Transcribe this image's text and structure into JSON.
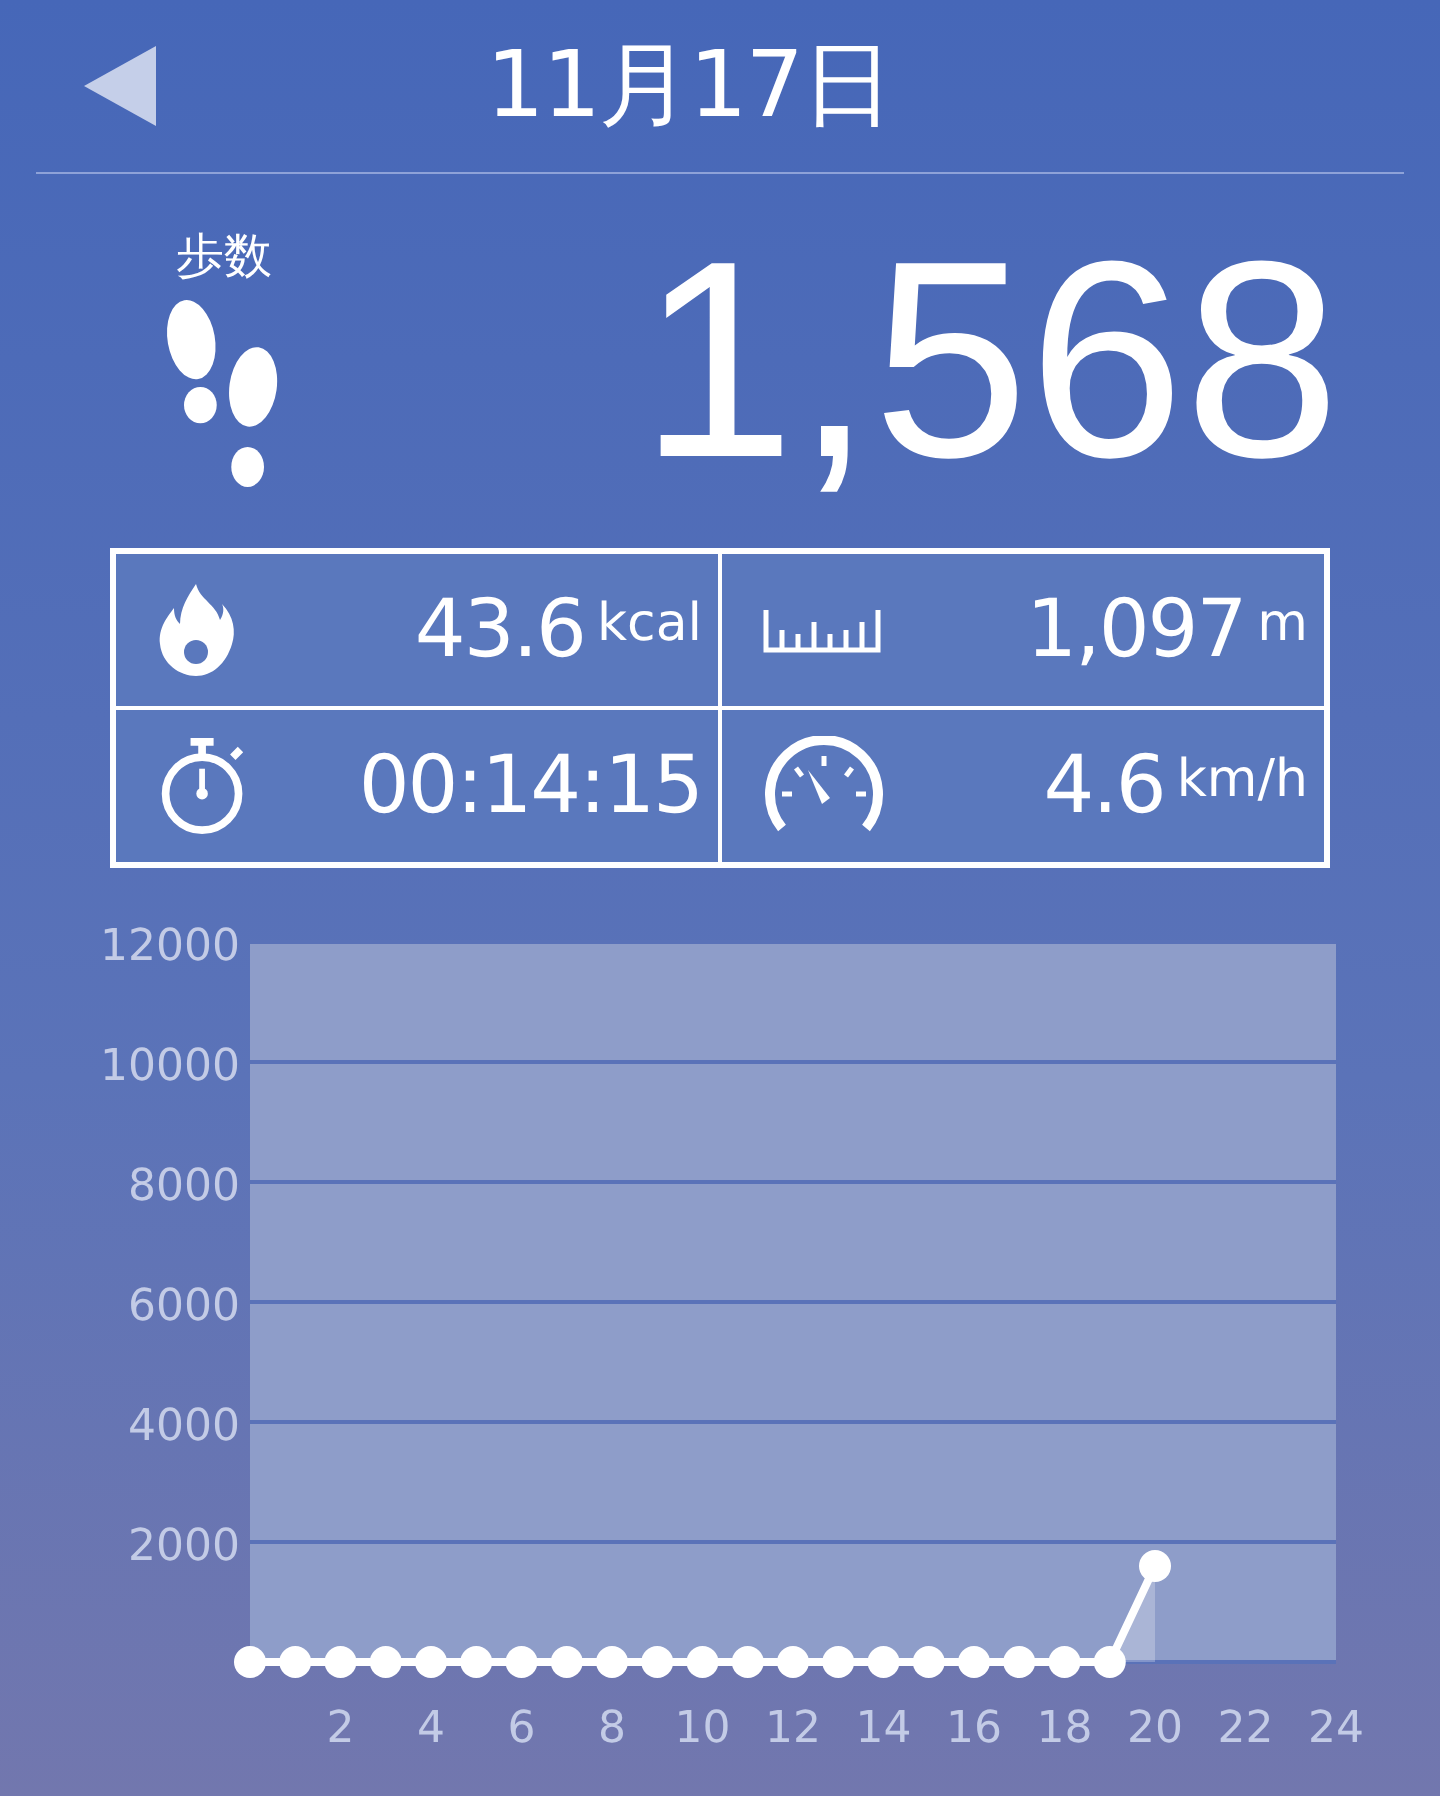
{
  "header": {
    "title": "11月17日"
  },
  "steps": {
    "label": "歩数",
    "value": "1,568"
  },
  "stats": [
    {
      "kind": "calories",
      "value": "43.6",
      "unit": "kcal"
    },
    {
      "kind": "distance",
      "value": "1,097",
      "unit": "m"
    },
    {
      "kind": "time",
      "value": "00:14:15"
    },
    {
      "kind": "speed",
      "value": "4.6",
      "unit": "km/h"
    }
  ],
  "chart": {
    "chart_data": {
      "type": "line",
      "x": [
        0,
        1,
        2,
        3,
        4,
        5,
        6,
        7,
        8,
        9,
        10,
        11,
        12,
        13,
        14,
        15,
        16,
        17,
        18,
        19,
        20
      ],
      "values": [
        0,
        0,
        0,
        0,
        0,
        0,
        0,
        0,
        0,
        0,
        0,
        0,
        0,
        0,
        0,
        0,
        0,
        0,
        0,
        0,
        1600
      ],
      "grid": true,
      "marker": true,
      "xlim": [
        0,
        24
      ],
      "ylim": [
        0,
        12000
      ],
      "xticks": [
        2,
        4,
        6,
        8,
        10,
        12,
        14,
        16,
        18,
        20,
        22,
        24
      ],
      "yticks": [
        2000,
        4000,
        6000,
        8000,
        10000,
        12000
      ]
    }
  }
}
